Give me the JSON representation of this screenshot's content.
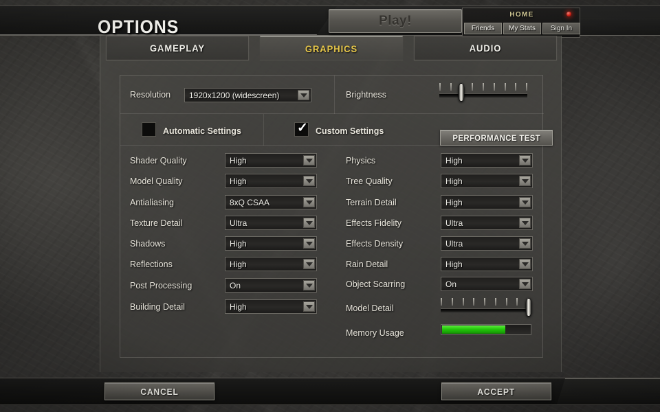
{
  "header": {
    "title": "OPTIONS",
    "play_label": "Play!",
    "account": {
      "home_label": "HOME",
      "links": [
        "Friends",
        "My Stats",
        "Sign In"
      ],
      "led_color": "#e02014"
    }
  },
  "tabs": [
    {
      "label": "GAMEPLAY",
      "active": false
    },
    {
      "label": "GRAPHICS",
      "active": true
    },
    {
      "label": "AUDIO",
      "active": false
    }
  ],
  "graphics": {
    "resolution": {
      "label": "Resolution",
      "value": "1920x1200 (widescreen)"
    },
    "brightness": {
      "label": "Brightness",
      "percent": 25,
      "ticks": 9
    },
    "automatic_settings": {
      "label": "Automatic Settings",
      "checked": false
    },
    "custom_settings": {
      "label": "Custom Settings",
      "checked": true,
      "tick_glyph": "✓"
    },
    "performance_test": {
      "label": "PERFORMANCE TEST"
    },
    "left_column": [
      {
        "label": "Shader Quality",
        "value": "High"
      },
      {
        "label": "Model Quality",
        "value": "High"
      },
      {
        "label": "Antialiasing",
        "value": "8xQ CSAA"
      },
      {
        "label": "Texture Detail",
        "value": "Ultra"
      },
      {
        "label": "Shadows",
        "value": "High"
      },
      {
        "label": "Reflections",
        "value": "High"
      },
      {
        "label": "Post Processing",
        "value": "On"
      },
      {
        "label": "Building Detail",
        "value": "High"
      }
    ],
    "right_column": [
      {
        "label": "Physics",
        "value": "High"
      },
      {
        "label": "Tree Quality",
        "value": "High"
      },
      {
        "label": "Terrain Detail",
        "value": "High"
      },
      {
        "label": "Effects Fidelity",
        "value": "Ultra"
      },
      {
        "label": "Effects Density",
        "value": "Ultra"
      },
      {
        "label": "Rain Detail",
        "value": "High"
      },
      {
        "label": "Object Scarring",
        "value": "On"
      }
    ],
    "model_detail": {
      "label": "Model Detail",
      "percent": 100,
      "ticks": 9
    },
    "memory_usage": {
      "label": "Memory Usage",
      "percent": 72,
      "fill_color": "#22c40a"
    }
  },
  "footer": {
    "cancel_label": "CANCEL",
    "accept_label": "ACCEPT"
  }
}
